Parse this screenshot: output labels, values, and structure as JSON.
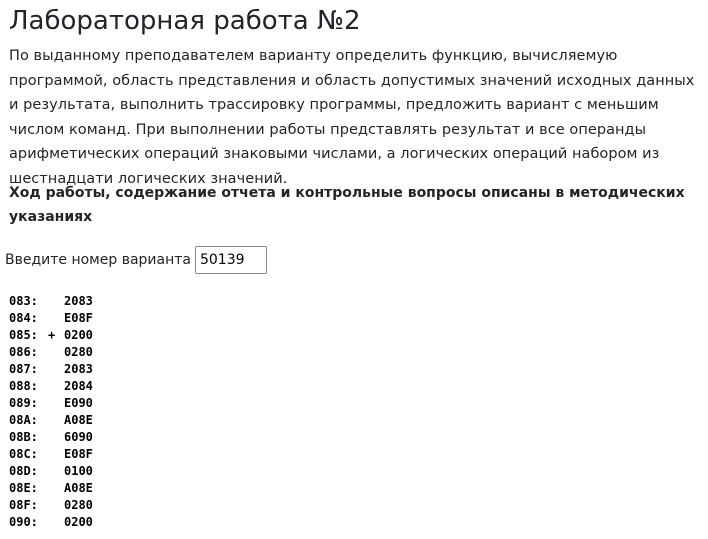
{
  "page": {
    "title": "Лабораторная работа №2",
    "intro": "По выданному преподавателем варианту определить функцию, вычисляемую программой, область представления и область допустимых значений исходных данных и результата, выполнить трассировку программы, предложить вариант с меньшим числом команд. При выполнении работы представлять результат и все операнды арифметических операций знаковыми числами, а логических операций набором из шестнадцати логических значений.",
    "subheading": "Ход работы, содержание отчета и контрольные вопросы описаны в методических указаниях"
  },
  "variant": {
    "label": "Введите номер варианта",
    "value": "50139"
  },
  "program": [
    {
      "addr": "083:",
      "marker": "",
      "word": "2083"
    },
    {
      "addr": "084:",
      "marker": "",
      "word": "E08F"
    },
    {
      "addr": "085:",
      "marker": "+",
      "word": "0200"
    },
    {
      "addr": "086:",
      "marker": "",
      "word": "0280"
    },
    {
      "addr": "087:",
      "marker": "",
      "word": "2083"
    },
    {
      "addr": "088:",
      "marker": "",
      "word": "2084"
    },
    {
      "addr": "089:",
      "marker": "",
      "word": "E090"
    },
    {
      "addr": "08A:",
      "marker": "",
      "word": "A08E"
    },
    {
      "addr": "08B:",
      "marker": "",
      "word": "6090"
    },
    {
      "addr": "08C:",
      "marker": "",
      "word": "E08F"
    },
    {
      "addr": "08D:",
      "marker": "",
      "word": "0100"
    },
    {
      "addr": "08E:",
      "marker": "",
      "word": "A08E"
    },
    {
      "addr": "08F:",
      "marker": "",
      "word": "0280"
    },
    {
      "addr": "090:",
      "marker": "",
      "word": "0200"
    }
  ]
}
